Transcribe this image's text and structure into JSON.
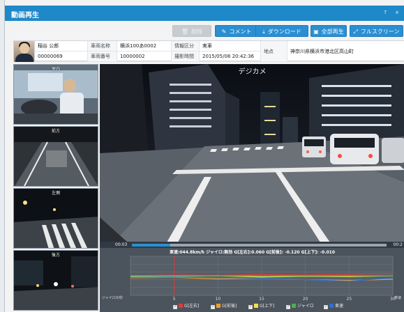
{
  "window": {
    "title": "動画再生",
    "controls": "? ×"
  },
  "toolbar": {
    "delete_label": "削除",
    "comment_label": "コメント",
    "download_label": "ダウンロード",
    "play_all_label": "全部再生",
    "fullscreen_label": "フルスクリーン"
  },
  "info": {
    "driver_name": "稲谷 公郎",
    "driver_id": "00000069",
    "vehicle_name_label": "車両名称",
    "vehicle_name": "横浜100あ0002",
    "vehicle_no_label": "車両番号",
    "vehicle_no": "10000002",
    "report_type_label": "情報区分",
    "report_type": "実車",
    "shot_time_label": "撮影時間",
    "shot_time": "2015/05/08 20:42:36",
    "place_label": "地点",
    "place": "神奈川県横浜市港北区高山町"
  },
  "thumbs": [
    "室内",
    "前方",
    "左側",
    "後方"
  ],
  "main": {
    "camera_label": "デジカメ"
  },
  "seek": {
    "start": "00:03",
    "end": "00:2",
    "progress": 0.15
  },
  "sensor": {
    "readout": "車速:044.8km/h  ジャイロ:無効  G[左右]:0.060  G[前後]: -0.120  G[上下]: -0.010",
    "left_axis_label": "ジャイロ",
    "left_axis_zero": "0/秒",
    "right_axis_label": "車速"
  },
  "chart_data": {
    "type": "line",
    "x_ticks": [
      5,
      10,
      15,
      20,
      25,
      30
    ],
    "series": [
      {
        "name": "G[左右]",
        "color": "#e53935",
        "values": [
          0.0,
          0.02,
          0.01,
          0.03,
          0.02,
          0.04,
          0.06
        ]
      },
      {
        "name": "G[前後]",
        "color": "#f39c2a",
        "values": [
          -0.05,
          -0.04,
          -0.08,
          -0.06,
          -0.1,
          -0.12,
          -0.09
        ]
      },
      {
        "name": "G[上下]",
        "color": "#f1e24a",
        "values": [
          -0.02,
          -0.01,
          0.0,
          -0.03,
          -0.01,
          -0.02,
          0.0
        ]
      },
      {
        "name": "ジャイロ",
        "color": "#4caf50",
        "values": [
          0,
          0,
          0,
          0,
          0,
          0,
          0
        ]
      },
      {
        "name": "車速",
        "color": "#2f6fd6",
        "values": [
          46,
          47,
          45,
          44,
          40,
          36,
          44.8
        ]
      }
    ],
    "marker_x": 5,
    "grid": true
  },
  "colors": {
    "accent": "#1e88c9",
    "button": "#2a8fd2",
    "graph_bg": "#4b535c"
  }
}
